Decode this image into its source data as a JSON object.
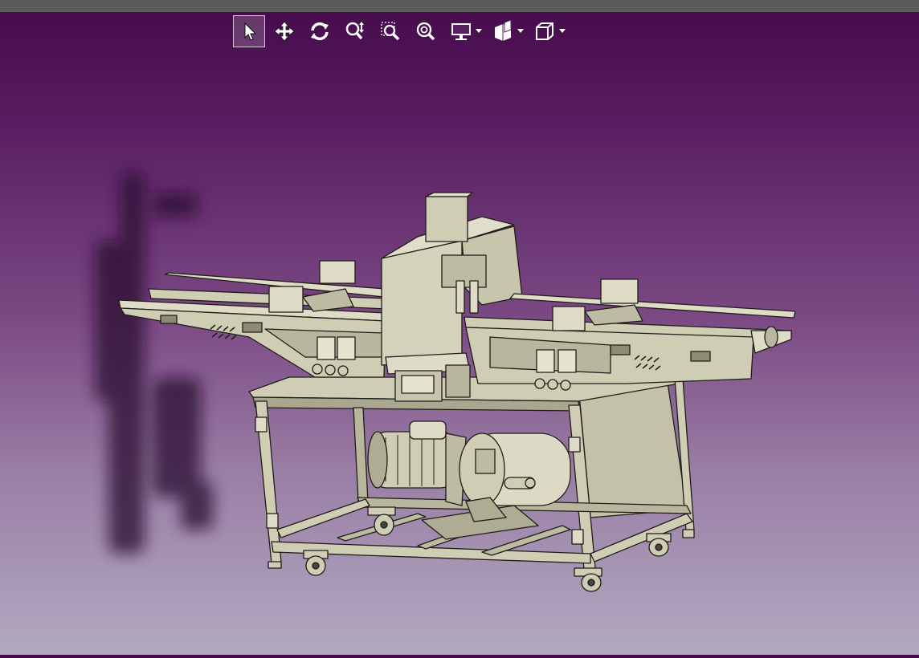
{
  "toolbar": {
    "tools": [
      {
        "id": "select",
        "icon": "cursor-arrow-icon",
        "active": true
      },
      {
        "id": "pan",
        "icon": "move-arrows-icon"
      },
      {
        "id": "rotate",
        "icon": "rotate-icon"
      },
      {
        "id": "zoom",
        "icon": "zoom-updown-icon"
      },
      {
        "id": "zoom-window",
        "icon": "zoom-window-icon"
      },
      {
        "id": "zoom-fit",
        "icon": "zoom-fit-icon"
      },
      {
        "id": "display-mode",
        "icon": "monitor-icon",
        "dropdown": true
      },
      {
        "id": "section",
        "icon": "section-cube-icon",
        "dropdown": true
      },
      {
        "id": "view-cube",
        "icon": "view-cube-icon",
        "dropdown": true
      }
    ]
  },
  "colors": {
    "topbar": "#5b5a5c",
    "background_top": "#440a4a",
    "background_bottom": "#b2a9c1",
    "model_fill": "#cfcdb4",
    "model_edge": "#1e1d18",
    "model_shade": "#a9a78f"
  }
}
